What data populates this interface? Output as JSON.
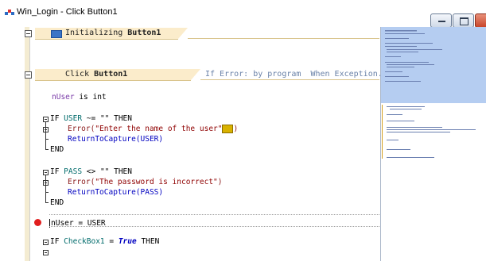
{
  "window": {
    "title": "Win_Login - Click Button1"
  },
  "editor": {
    "init_block": {
      "label": "Initializing",
      "target": "Button1"
    },
    "click_block": {
      "label": "Click",
      "target": "Button1",
      "error_mode": "If Error: by program  When Exception..."
    },
    "lines": {
      "l1_var": "nUser",
      "l1_rest": " is int",
      "if1_kw": "IF ",
      "if1_var": "USER",
      "if1_rest": " ~= \"\" THEN",
      "err1_fn": "Error(",
      "err1_str": "\"Enter the name of the user\"",
      "err1_end": ")",
      "ret1": "ReturnToCapture(USER)",
      "end1": "END",
      "if2_kw": "IF ",
      "if2_var": "PASS",
      "if2_rest": " <> \"\" THEN",
      "err2_fn": "Error(",
      "err2_str": "\"The password is incorrect\"",
      "err2_end": ")",
      "ret2": "ReturnToCapture(PASS)",
      "end2": "END",
      "assign": "nUser = USER",
      "if3_kw": "IF ",
      "if3_var": "CheckBox1",
      "if3_eq": " = ",
      "if3_true": "True",
      "if3_then": " THEN"
    }
  },
  "colors": {
    "header_fill": "#fbeccb",
    "breakpoint": "#e11f1f",
    "minimap_view": "#b5cdf1"
  },
  "icons": [
    "window-app-icon",
    "minimize-icon",
    "maximize-icon",
    "close-icon",
    "collapse-icon",
    "breakpoint-icon",
    "warning-icon",
    "event-icon"
  ]
}
